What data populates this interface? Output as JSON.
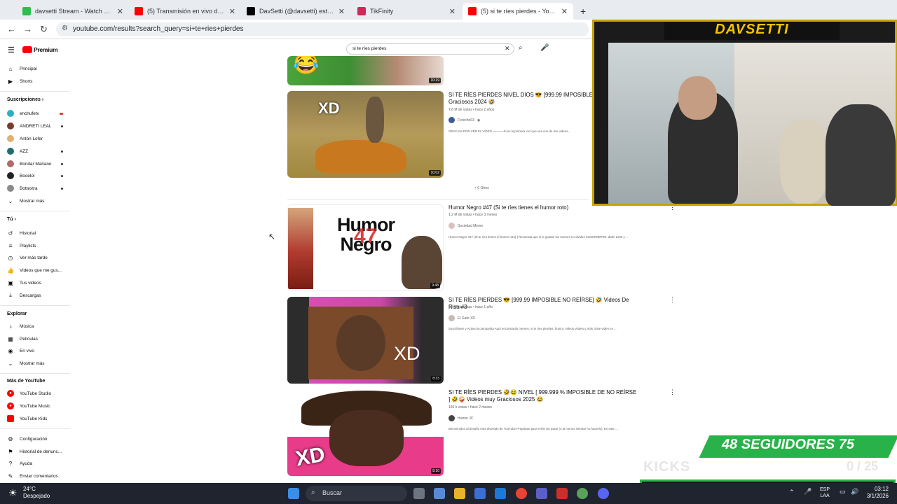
{
  "browser": {
    "tabs": [
      {
        "title": "davsetti Stream - Watch Live on",
        "color": "#2ebd4f"
      },
      {
        "title": "(5) Transmisión en vivo de Dav",
        "color": "#ff0000"
      },
      {
        "title": "DavSetti (@davsetti) está LIVE",
        "color": "#000000"
      },
      {
        "title": "TikFinity",
        "color": "#d1285a"
      },
      {
        "title": "(5) si te ríes pierdes - YouTube",
        "color": "#ff0000"
      }
    ],
    "url": "youtube.com/results?search_query=si+te+ries+pierdes"
  },
  "youtube": {
    "logo_text": "Premium",
    "search_value": "si te ríes pierdes",
    "sidebar": {
      "main": [
        "Principal",
        "Shorts"
      ],
      "subs_heading": "Suscripciones",
      "subs": [
        "enchufetv",
        "ANDRETI LEAL",
        "Antón Lofer",
        "AZZ",
        "Bondar Mariano",
        "Booelol",
        "Bottextra",
        "Mostrar más"
      ],
      "you_heading": "Tú",
      "you": [
        "Historial",
        "Playlists",
        "Ver más tarde",
        "Videos que me gus...",
        "Tus videos",
        "Descargas"
      ],
      "explore_heading": "Explorar",
      "explore": [
        "Música",
        "Películas",
        "En vivo",
        "Mostrar más"
      ],
      "more_heading": "Más de YouTube",
      "more": [
        "YouTube Studio",
        "YouTube Music",
        "YouTube Kids"
      ],
      "bottom": [
        "Configuración",
        "Historial de denunc...",
        "Ayuda",
        "Enviar comentarios"
      ]
    },
    "results": [
      {
        "duration": "10:19"
      },
      {
        "title": "SI TE RÍES PIERDES NIVEL DIOS 😎 [999.99 IMPOSIBLE N... Risa Muy Graciosos 2024 🤣",
        "meta": "7.8 M de vistas • hace 2 años",
        "channel": "Ferecho03",
        "desc": "GRACIAS POR VER EL VIDEO ~~~~~~Si es la primera vez que ves uno de mis videos...",
        "duration": "10:02",
        "thumb_text": "XD"
      },
      {
        "title": "Humor Negro #47 (Si te ríes tienes el humor roto)",
        "meta": "1.2 M de vistas • hace 3 meses",
        "channel": "Sociedad Meme",
        "desc": "Humor Negro #47 (Si te ríes tienes el humor roto) | Recuerda que si te gustan los memes no olvides SUSCRIBIRTE, darle LIKE y ...",
        "duration": "9:48",
        "thumb_text": "Humor Negro",
        "thumb_num": "47"
      },
      {
        "title": "SI TE RÍES PIERDES 😎 [999.99 IMPOSIBLE NO REÍRSE] 🤣 Videos De Risa #3",
        "meta": "2.6 M de vistas • hace 1 año",
        "channel": "El Gato XD",
        "desc": "Suscríbete! y Activa la campanita Aquí encontrarás memes, si te ríes pierdes, humor, videos virales y más. Este video es ...",
        "duration": "8:33",
        "thumb_text": "XD"
      },
      {
        "title": "SI TE RÍES PIERDES 🤣😂 NIVEL [ 999.999 % IMPOSIBLE DE NO REÍRSE ] 🤣🤪 Videos muy Graciosos 2025 😂",
        "meta": "160 k vistas • hace 2 meses",
        "channel": "Humor JC",
        "desc": "Bienvenidos al desafío más divertido de YouTube Prepárate para reírte sin parar (o al menos intentar no hacerlo). En este ...",
        "duration": "8:10",
        "thumb_text": "XD"
      }
    ],
    "more_label": "+ 6 Otros"
  },
  "overlay": {
    "streamer": "DAVSETTI",
    "goal": "48 SEGUIDORES 75",
    "kicks_label": "KICKS",
    "kicks_count": "0 / 25"
  },
  "taskbar": {
    "weather_temp": "24°C",
    "weather_desc": "Despejado",
    "search": "Buscar",
    "lang": "ESP",
    "lang2": "LAA",
    "time": "03:12",
    "date": "3/1/2026"
  }
}
